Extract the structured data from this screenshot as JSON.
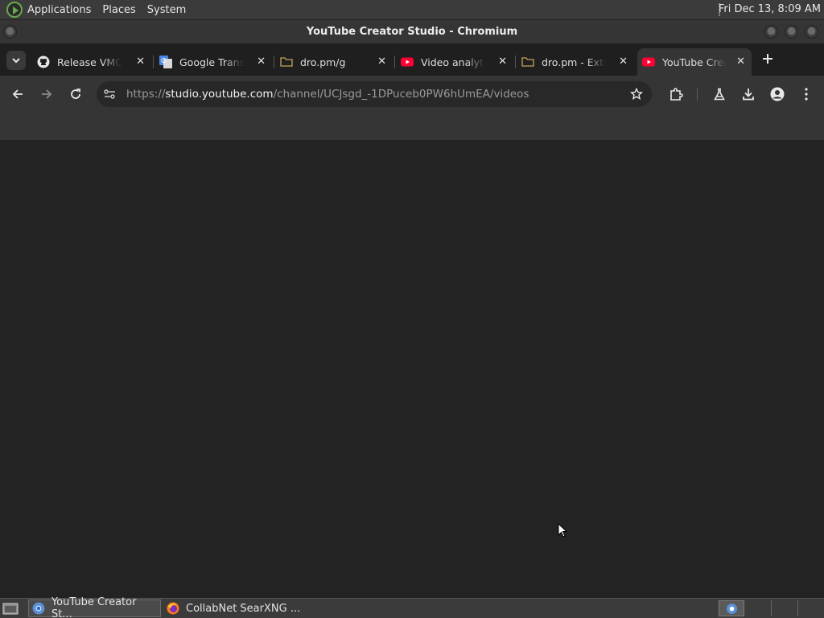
{
  "top_panel": {
    "menus": [
      "Applications",
      "Places",
      "System"
    ],
    "clock": "Fri Dec 13,  8:09 AM"
  },
  "window": {
    "title": "YouTube Creator Studio - Chromium"
  },
  "tabs": [
    {
      "label": "Release VMQ",
      "icon": "github-icon"
    },
    {
      "label": "Google Trans",
      "icon": "google-translate-icon"
    },
    {
      "label": "dro.pm/g",
      "icon": "folder-icon"
    },
    {
      "label": "Video analytic",
      "icon": "youtube-icon"
    },
    {
      "label": "dro.pm - Extr",
      "icon": "folder-icon"
    },
    {
      "label": "YouTube Crea",
      "icon": "youtube-studio-icon"
    }
  ],
  "address_bar": {
    "scheme": "https://",
    "host": "studio.youtube.com",
    "path": "/channel/UCJsgd_-1DPuceb0PW6hUmEA/videos"
  },
  "taskbar": {
    "items": [
      {
        "label": "YouTube Creator St...",
        "icon": "chromium-icon"
      },
      {
        "label": "CollabNet SearXNG ...",
        "icon": "firefox-icon"
      }
    ]
  },
  "colors": {
    "youtube_red": "#ff0033",
    "content_bg": "#232323",
    "toolbar_bg": "#353535"
  }
}
